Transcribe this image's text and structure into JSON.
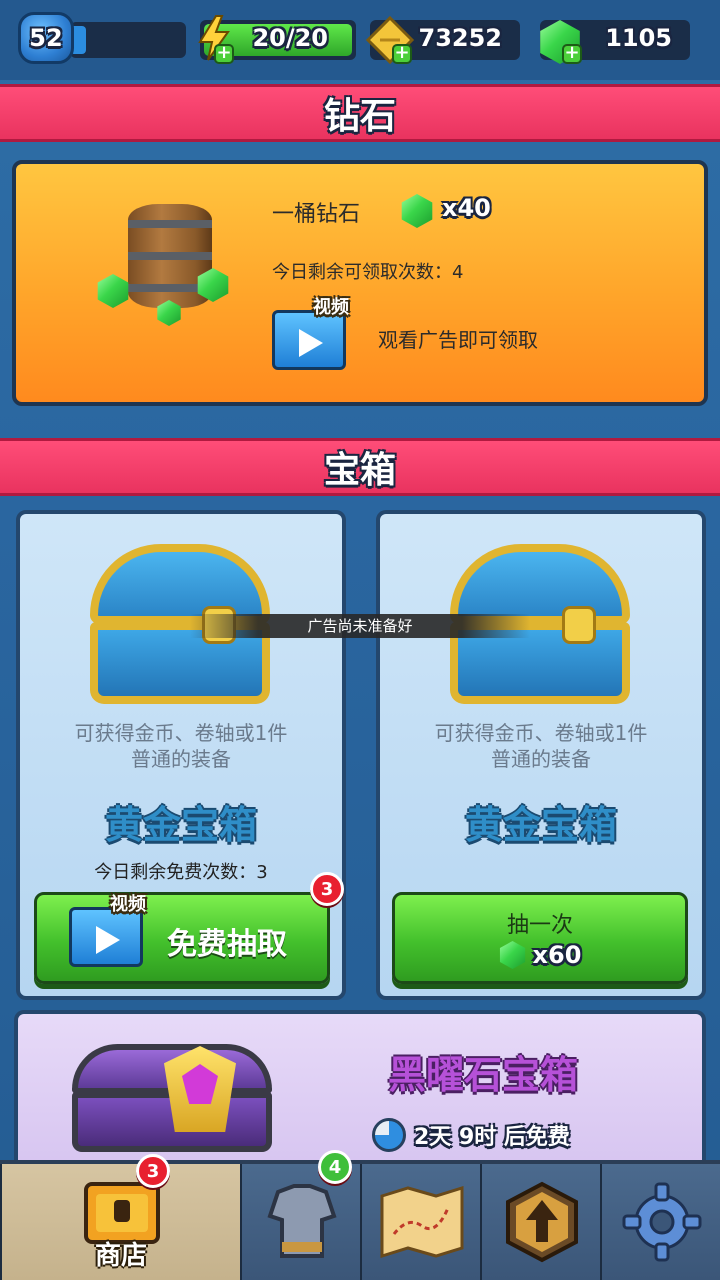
{
  "topbar": {
    "level": "52",
    "energy": "20/20",
    "energy_fill": 1.0,
    "gold": "73252",
    "gems": "1105"
  },
  "sections": {
    "diamond_banner": "钻石",
    "chest_banner": "宝箱"
  },
  "diamond_offer": {
    "name": "一桶钻石",
    "amount": "x40",
    "remaining": "今日剩余可领取次数：4",
    "video_tag": "视频",
    "watch_hint": "观看广告即可领取"
  },
  "toast": "广告尚未准备好",
  "chests": [
    {
      "desc_line1": "可获得金币、卷轴或1件",
      "desc_line2": "普通的装备",
      "title": "黄金宝箱",
      "remaining": "今日剩余免费次数：3",
      "video_tag": "视频",
      "button_label": "免费抽取",
      "badge": "3"
    },
    {
      "desc_line1": "可获得金币、卷轴或1件",
      "desc_line2": "普通的装备",
      "title": "黄金宝箱",
      "button_label": "抽一次",
      "cost": "x60"
    }
  ],
  "obsidian": {
    "title": "黑曜石宝箱",
    "timer": "2天 9时 后免费"
  },
  "nav": {
    "shop_label": "商店",
    "shop_badge": "3",
    "equipment_badge": "4"
  },
  "colors": {
    "banner": "#e9335f",
    "green_button": "#43c02c",
    "chest_title": "#2f8ec8"
  }
}
